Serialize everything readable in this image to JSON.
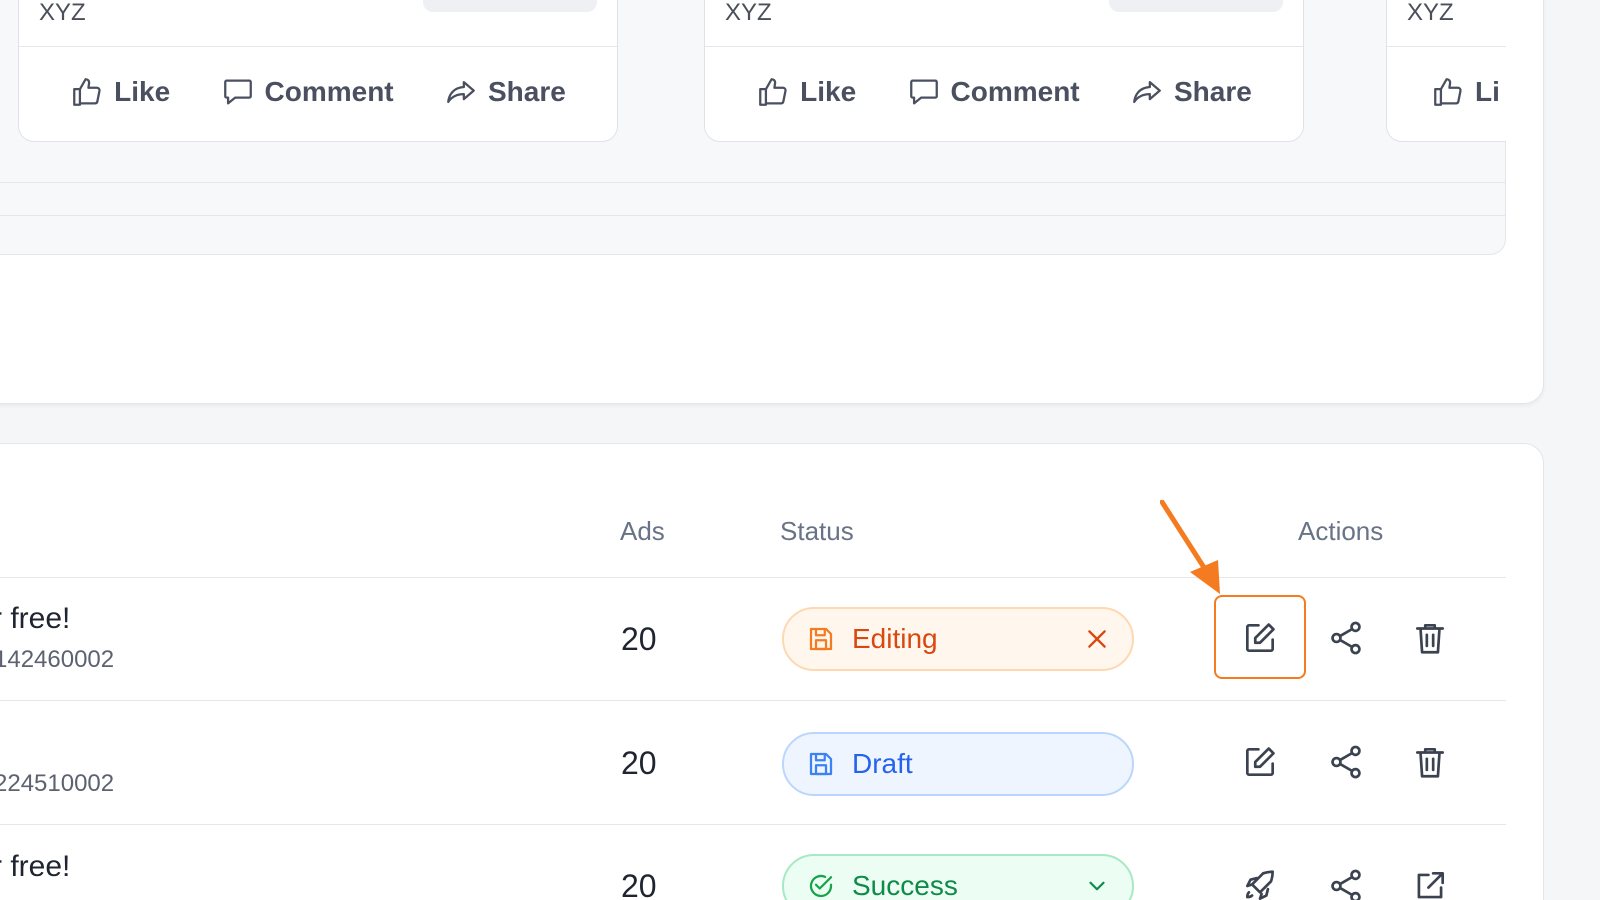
{
  "posts": [
    {
      "author": "XYZ",
      "like": "Like",
      "comment": "Comment",
      "share": "Share"
    },
    {
      "author": "XYZ",
      "like": "Like",
      "comment": "Comment",
      "share": "Share"
    },
    {
      "author": "XYZ",
      "like": "Li"
    }
  ],
  "table": {
    "headers": {
      "ads": "Ads",
      "status": "Status",
      "actions": "Actions"
    },
    "rows": [
      {
        "title": "r free!",
        "id": "142460002",
        "ads": "20",
        "status": "Editing",
        "status_end_icon": "close-icon",
        "actions": [
          "edit-icon",
          "share-icon",
          "trash-icon"
        ]
      },
      {
        "title": "",
        "id": "224510002",
        "ads": "20",
        "status": "Draft",
        "actions": [
          "edit-icon",
          "share-icon",
          "trash-icon"
        ]
      },
      {
        "title": "r free!",
        "id": "",
        "ads": "20",
        "status": "Success",
        "status_end_icon": "chevron-down-icon",
        "actions": [
          "rocket-icon",
          "share-icon",
          "external-link-icon"
        ]
      }
    ]
  },
  "colors": {
    "highlight": "#f47b20",
    "editing": "#d9480f",
    "draft": "#2563eb",
    "success": "#0f8a48"
  }
}
